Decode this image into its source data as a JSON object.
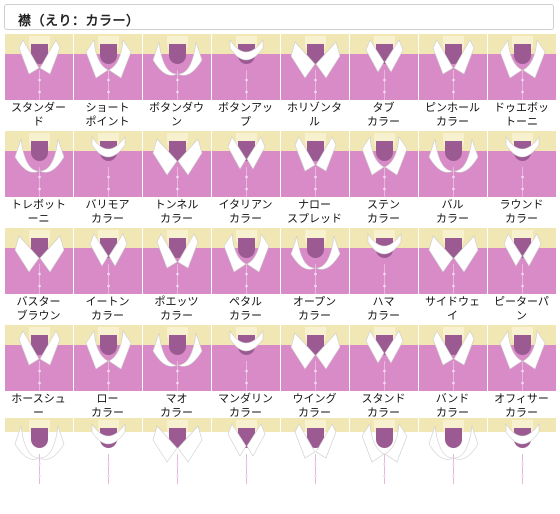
{
  "title": "襟（えり：カラー）",
  "rows": [
    [
      "スタンダー\nド",
      "ショート\nポイント",
      "ボタンダウ\nン",
      "ボタンアッ\nプ",
      "ホリゾンタ\nル",
      "タブ\nカラー",
      "ピンホール\nカラー",
      "ドゥエボッ\nトーニ"
    ],
    [
      "トレボット\nーニ",
      "バリモア\nカラー",
      "トンネル\nカラー",
      "イタリアン\nカラー",
      "ナロー\nスプレッド",
      "ステン\nカラー",
      "バル\nカラー",
      "ラウンド\nカラー"
    ],
    [
      "バスター\nブラウン",
      "イートン\nカラー",
      "ポエッツ\nカラー",
      "ペタル\nカラー",
      "オープン\nカラー",
      "ハマ\nカラー",
      "サイドウェ\nイ",
      "ピーターパ\nン"
    ],
    [
      "ホースシュ\nー",
      "ロー\nカラー",
      "マオ\nカラー",
      "マンダリン\nカラー",
      "ウイング\nカラー",
      "スタンド\nカラー",
      "バンド\nカラー",
      "オフィサー\nカラー"
    ],
    [
      "",
      "",
      "",
      "",
      "",
      "",
      "",
      ""
    ]
  ],
  "colors": {
    "shirt": "#d98bc8",
    "background": "#f0e7b5",
    "collar": "#ffffff"
  }
}
